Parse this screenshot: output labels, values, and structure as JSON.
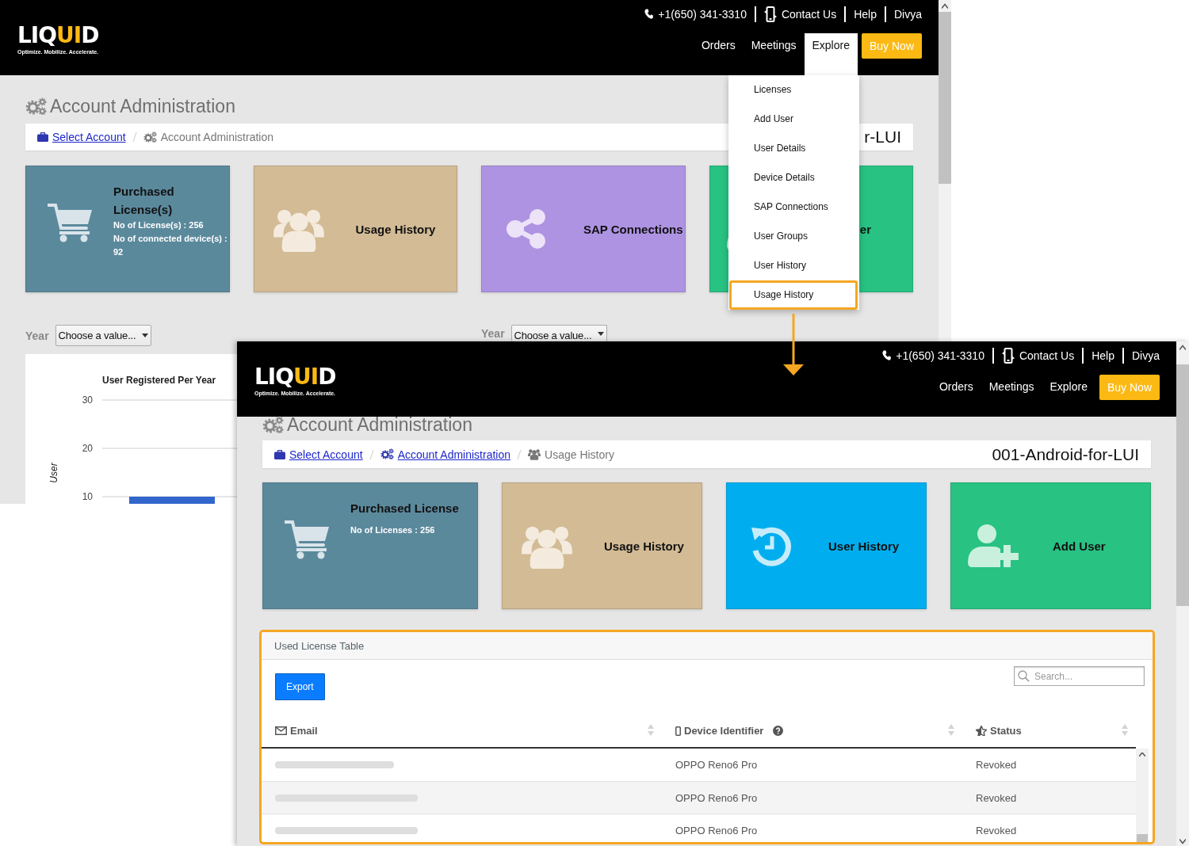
{
  "screens": [
    {
      "header": {
        "logo": [
          "LIQ",
          "UI",
          "D"
        ],
        "tagline": "Optimize. Mobilize. Accelerate.",
        "phone": "+1(650) 341-3310",
        "links": [
          "Contact Us",
          "Help",
          "Divya"
        ],
        "nav": [
          {
            "label": "Orders",
            "selected": false
          },
          {
            "label": "Meetings",
            "selected": false
          },
          {
            "label": "Explore",
            "selected": true
          }
        ],
        "cta": "Buy Now"
      },
      "page_title": "Account Administration",
      "breadcrumbs": [
        {
          "label": "Select Account",
          "kind": "account",
          "link": true
        },
        {
          "label": "Account Administration",
          "kind": "admin",
          "link": false
        }
      ],
      "account": "r-LUI",
      "tiles": [
        {
          "kind": "cart",
          "title": "Purchased License(s)",
          "details": [
            "No of License(s) : 256",
            "No of connected device(s) : 92"
          ],
          "color": "#5b899c"
        },
        {
          "kind": "group",
          "title": "Usage History",
          "color": "#d2bb95"
        },
        {
          "kind": "share",
          "title": "SAP Connections",
          "color": "#ae93e2"
        },
        {
          "kind": "covered",
          "title": "er",
          "color": "#28c283"
        }
      ],
      "filters": [
        {
          "label": "Year",
          "value": "Choose a value..."
        },
        {
          "label": "Year",
          "value": "Choose a value..."
        }
      ],
      "chart": {
        "chart_data": {
          "type": "bar",
          "title": "User Registered Per Year",
          "ylabel": "User",
          "values": [
            10
          ],
          "yticks": [
            10,
            20,
            30
          ],
          "ylim": [
            0,
            30
          ]
        }
      },
      "menu": [
        {
          "label": "Licenses",
          "selected": false
        },
        {
          "label": "Add User",
          "selected": false
        },
        {
          "label": "User Details",
          "selected": false
        },
        {
          "label": "Device Details",
          "selected": false
        },
        {
          "label": "SAP Connections",
          "selected": false
        },
        {
          "label": "User Groups",
          "selected": false
        },
        {
          "label": "User History",
          "selected": false
        },
        {
          "label": "Usage History",
          "selected": true
        }
      ]
    },
    {
      "header": {
        "logo": [
          "LIQ",
          "UI",
          "D"
        ],
        "tagline": "Optimize. Mobilize. Accelerate.",
        "phone": "+1(650) 341-3310",
        "links": [
          "Contact Us",
          "Help",
          "Divya"
        ],
        "nav": [
          {
            "label": "Orders",
            "selected": false
          },
          {
            "label": "Meetings",
            "selected": false
          },
          {
            "label": "Explore",
            "selected": false
          }
        ],
        "cta": "Buy Now"
      },
      "page_title": "Account Administration",
      "breadcrumbs": [
        {
          "label": "Select Account",
          "kind": "account",
          "link": true
        },
        {
          "label": "Account Administration",
          "kind": "admin",
          "link": true
        },
        {
          "label": "Usage History",
          "kind": "users",
          "link": false
        }
      ],
      "account": "001-Android-for-LUI",
      "tiles": [
        {
          "kind": "cart",
          "title": "Purchased License",
          "details": [
            "No of Licenses : 256"
          ],
          "color": "#5b899c"
        },
        {
          "kind": "group",
          "title": "Usage History",
          "color": "#d2bb95"
        },
        {
          "kind": "history",
          "title": "User History",
          "color": "#00aeef"
        },
        {
          "kind": "adduser",
          "title": "Add User",
          "color": "#28c283"
        }
      ],
      "table": {
        "title": "Used License Table",
        "export": "Export",
        "search": {
          "placeholder": "Search..."
        },
        "columns": [
          {
            "label": "Email",
            "kind": "email"
          },
          {
            "label": "Device Identifier",
            "kind": "device"
          },
          {
            "label": "Status",
            "kind": "status"
          }
        ],
        "rows": [
          {
            "email": {
              "kind": "redacted"
            },
            "device": "OPPO Reno6 Pro",
            "status": "Revoked"
          },
          {
            "email": {
              "kind": "redacted"
            },
            "device": "OPPO Reno6 Pro",
            "status": "Revoked"
          },
          {
            "email": {
              "kind": "redacted"
            },
            "device": "OPPO Reno6 Pro",
            "status": "Revoked"
          }
        ]
      }
    }
  ]
}
